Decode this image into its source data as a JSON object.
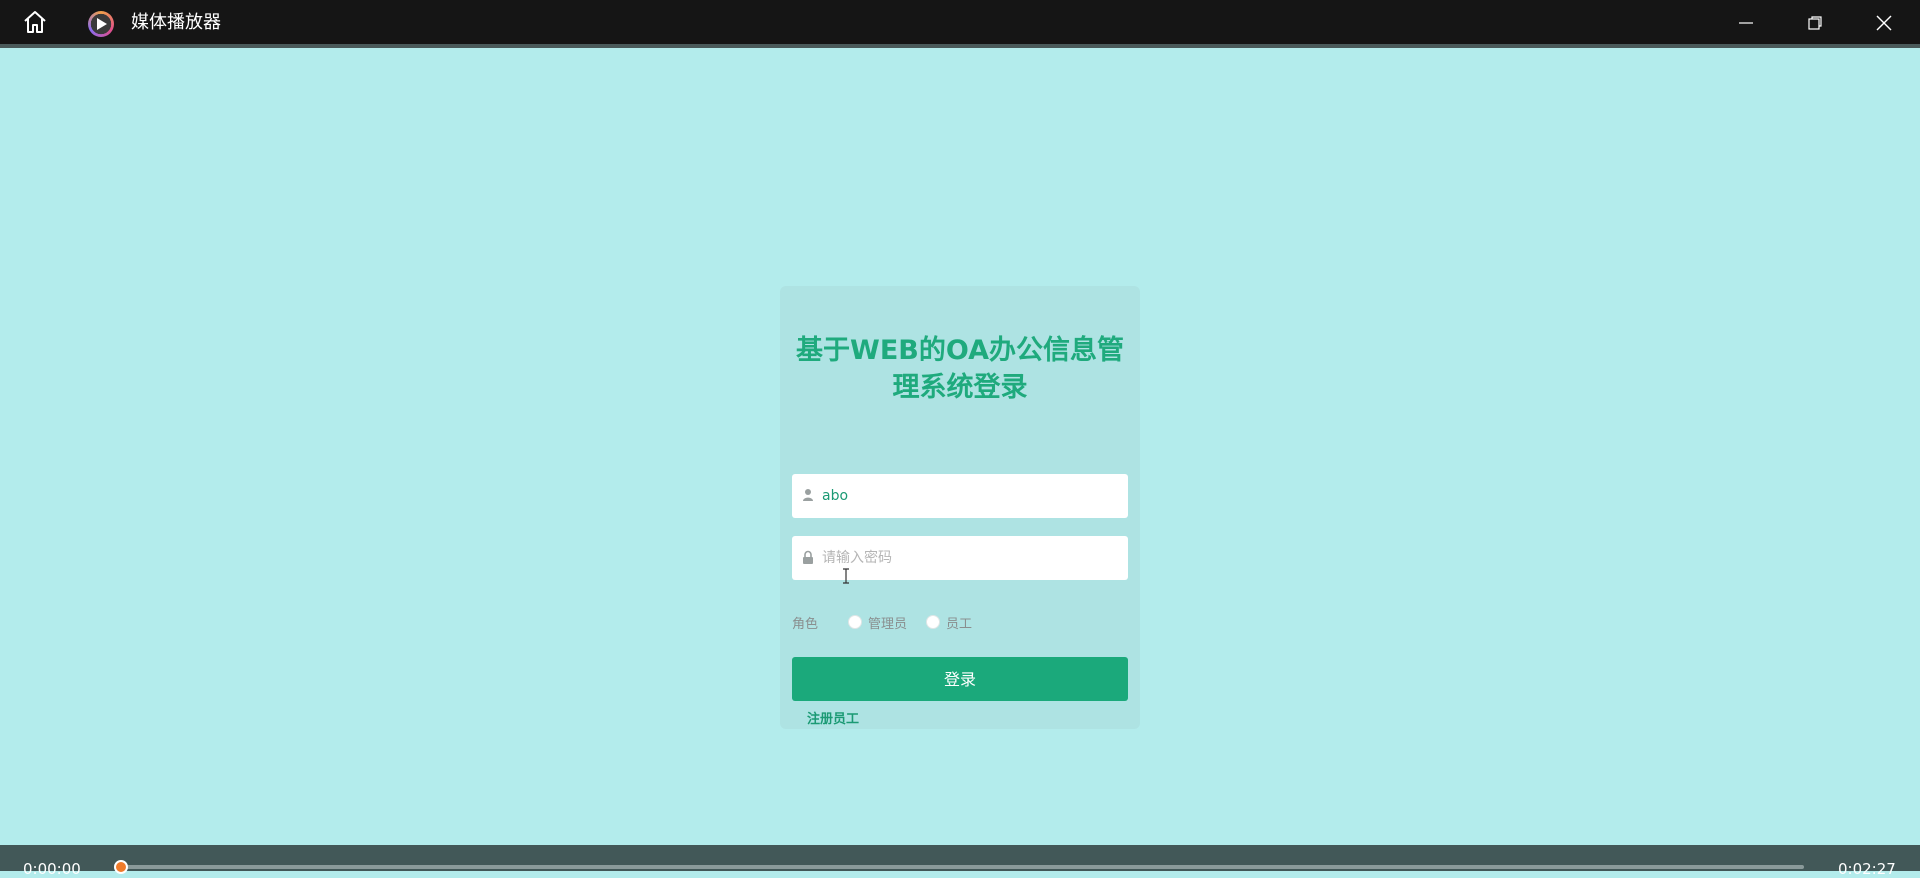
{
  "window": {
    "app_title": "媒体播放器",
    "icons": {
      "home": "home-icon",
      "app_logo": "media-player-logo",
      "minimize": "minimize-icon",
      "maximize": "restore-icon",
      "close": "close-icon"
    }
  },
  "login": {
    "title": "基于WEB的OA办公信息管理系统登录",
    "username": {
      "value": "abo",
      "icon": "user-icon"
    },
    "password": {
      "placeholder": "请输入密码",
      "icon": "lock-icon"
    },
    "role": {
      "label": "角色",
      "options": [
        "管理员",
        "员工"
      ],
      "selected": null
    },
    "submit_label": "登录",
    "register_label": "注册员工"
  },
  "player": {
    "elapsed": "0:00:00",
    "total": "0:02:27",
    "progress": 0.0
  },
  "colors": {
    "background": "#b3ecec",
    "accent_green": "#1ba97b",
    "title_green": "#1faa7d",
    "progress_orange": "#f07b2a"
  }
}
